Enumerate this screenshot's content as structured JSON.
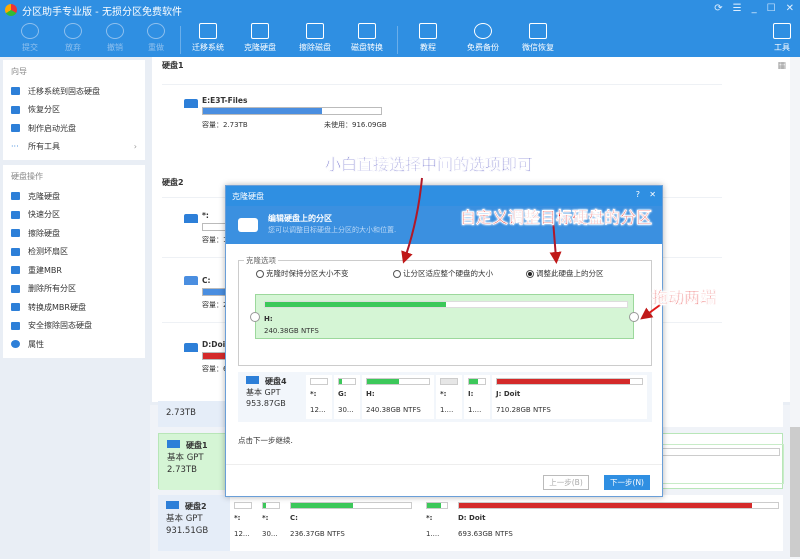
{
  "app": {
    "title": "分区助手专业版 - 无损分区免费软件"
  },
  "window_controls": [
    "⟳",
    "☰",
    "_",
    "☐",
    "✕"
  ],
  "toolbar": [
    {
      "label": "提交",
      "disabled": true
    },
    {
      "label": "放弃",
      "disabled": true
    },
    {
      "label": "撤销",
      "disabled": true
    },
    {
      "label": "重做",
      "disabled": true
    },
    {
      "label": "迁移系统"
    },
    {
      "label": "克隆硬盘"
    },
    {
      "label": "擦除磁盘"
    },
    {
      "label": "磁盘转换"
    },
    {
      "label": "教程"
    },
    {
      "label": "免费备份"
    },
    {
      "label": "微信恢复"
    },
    {
      "label": "工具"
    }
  ],
  "sidebar": {
    "wizard": {
      "title": "向导",
      "items": [
        "迁移系统到固态硬盘",
        "恢复分区",
        "制作启动光盘",
        "所有工具"
      ]
    },
    "disk_ops": {
      "title": "硬盘操作",
      "items": [
        "克隆硬盘",
        "快速分区",
        "擦除硬盘",
        "检测坏扇区",
        "重建MBR",
        "删除所有分区",
        "转换成MBR硬盘",
        "安全擦除固态硬盘",
        "属性"
      ]
    }
  },
  "main": {
    "disk1": {
      "title": "硬盘1",
      "partition": "E:E3T-Files",
      "capacity": "容量：2.73TB",
      "unused": "未使用：916.09GB",
      "fill": 0.67
    },
    "disk2": {
      "title": "硬盘2",
      "partitions": [
        {
          "name": "*:",
          "capacity": "容量：128"
        },
        {
          "name": "C:",
          "capacity": "容量：236"
        },
        {
          "name": "D:Doit",
          "capacity": "容量：693"
        }
      ]
    }
  },
  "lower": {
    "prev_size": "2.73TB",
    "disk1": {
      "name": "硬盘1",
      "type": "基本 GPT",
      "size": "2.73TB"
    },
    "disk2": {
      "name": "硬盘2",
      "type": "基本 GPT",
      "size": "931.51GB",
      "partitions": [
        {
          "name": "*:",
          "info": "12..."
        },
        {
          "name": "*:",
          "info": "30..."
        },
        {
          "name": "C:",
          "info": "236.37GB NTFS"
        },
        {
          "name": "*:",
          "info": "1...."
        },
        {
          "name": "D: Doit",
          "info": "693.63GB NTFS"
        }
      ]
    }
  },
  "dialog": {
    "title": "克隆硬盘",
    "help": "?",
    "close": "✕",
    "heading": "编辑硬盘上的分区",
    "subheading": "您可以调整目标硬盘上分区的大小和位置.",
    "group_label": "克隆选项",
    "options": [
      {
        "label": "克隆时保持分区大小不变",
        "selected": false
      },
      {
        "label": "让分区适应整个硬盘的大小",
        "selected": false
      },
      {
        "label": "调整此硬盘上的分区",
        "selected": true
      }
    ],
    "partition": {
      "name": "H:",
      "info": "240.38GB NTFS",
      "fill": 0.5
    },
    "disk4": {
      "name": "硬盘4",
      "type": "基本 GPT",
      "size": "953.87GB",
      "partitions": [
        {
          "name": "*:",
          "info": "12..."
        },
        {
          "name": "G:",
          "info": "30..."
        },
        {
          "name": "H:",
          "info": "240.38GB NTFS"
        },
        {
          "name": "*:",
          "info": "1...."
        },
        {
          "name": "I:",
          "info": "1...."
        },
        {
          "name": "J: Doit",
          "info": "710.28GB NTFS"
        }
      ]
    },
    "hint": "点击下一步继续.",
    "back": "上一步(B)",
    "next": "下一步(N)"
  },
  "annotations": {
    "middle": "小白直接选择中间的选项即可",
    "custom": "自定义调整目标硬盘的分区",
    "drag": "拖动两端"
  },
  "colors": {
    "brand": "#2f8fe2",
    "green": "#3cc85a",
    "red": "#d42a2a",
    "annotation_blue": "#3a3ab8",
    "annotation_red": "#e01818"
  }
}
